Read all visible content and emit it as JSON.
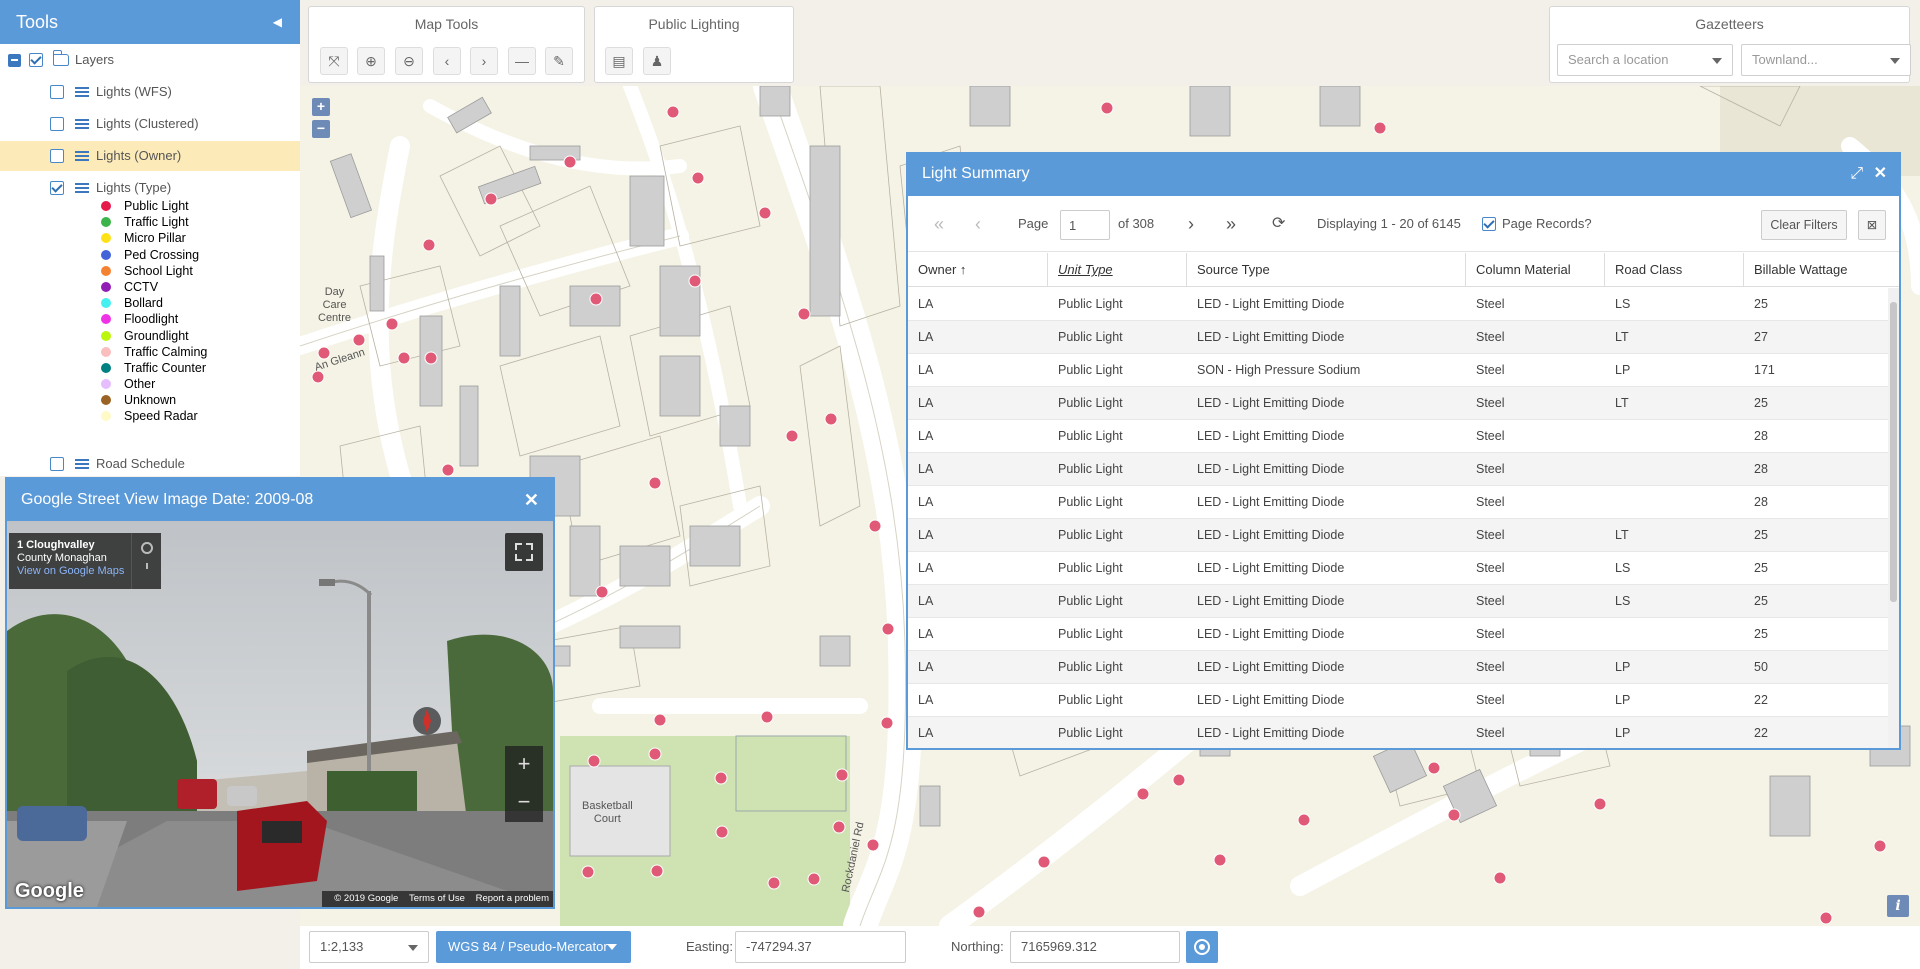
{
  "tools": {
    "title": "Tools",
    "layers_label": "Layers",
    "items": [
      {
        "label": "Lights (WFS)",
        "checked": false
      },
      {
        "label": "Lights (Clustered)",
        "checked": false
      },
      {
        "label": "Lights (Owner)",
        "checked": false
      },
      {
        "label": "Lights (Type)",
        "checked": true
      },
      {
        "label": "Road Schedule",
        "checked": false
      }
    ],
    "legend": [
      {
        "label": "Public Light",
        "color": "#e6194b"
      },
      {
        "label": "Traffic Light",
        "color": "#3cb44b"
      },
      {
        "label": "Micro Pillar",
        "color": "#ffe119"
      },
      {
        "label": "Ped Crossing",
        "color": "#4363d8"
      },
      {
        "label": "School Light",
        "color": "#f58231"
      },
      {
        "label": "CCTV",
        "color": "#911eb4"
      },
      {
        "label": "Bollard",
        "color": "#46f0f0"
      },
      {
        "label": "Floodlight",
        "color": "#f032e6"
      },
      {
        "label": "Groundlight",
        "color": "#bcf60c"
      },
      {
        "label": "Traffic Calming",
        "color": "#fabebe"
      },
      {
        "label": "Traffic Counter",
        "color": "#008080"
      },
      {
        "label": "Other",
        "color": "#e6beff"
      },
      {
        "label": "Unknown",
        "color": "#9a6324"
      },
      {
        "label": "Speed Radar",
        "color": "#fffac8"
      }
    ]
  },
  "map_tools": {
    "title": "Map Tools"
  },
  "public_lighting": {
    "title": "Public Lighting"
  },
  "gazetteers": {
    "title": "Gazetteers",
    "location_placeholder": "Search a location",
    "townland_placeholder": "Townland..."
  },
  "map": {
    "labels": {
      "day_care": "Day\nCare\nCentre",
      "an_gleann": "An Gleann",
      "basketball": "Basketball\nCourt",
      "rockdaniel": "Rockdaniel Rd"
    },
    "zoom_in": "+",
    "zoom_out": "−",
    "info": "i"
  },
  "summary": {
    "title": "Light Summary",
    "page_label": "Page",
    "page_value": "1",
    "of_pages": "of 308",
    "displaying": "Displaying 1 - 20 of 6145",
    "page_records": "Page Records?",
    "clear_filters": "Clear Filters",
    "columns": [
      "Owner",
      "Unit Type",
      "Source Type",
      "Column Material",
      "Road Class",
      "Billable Wattage"
    ],
    "rows": [
      [
        "LA",
        "Public Light",
        "LED - Light Emitting Diode",
        "Steel",
        "LS",
        "25"
      ],
      [
        "LA",
        "Public Light",
        "LED - Light Emitting Diode",
        "Steel",
        "LT",
        "27"
      ],
      [
        "LA",
        "Public Light",
        "SON - High Pressure Sodium",
        "Steel",
        "LP",
        "171"
      ],
      [
        "LA",
        "Public Light",
        "LED - Light Emitting Diode",
        "Steel",
        "LT",
        "25"
      ],
      [
        "LA",
        "Public Light",
        "LED - Light Emitting Diode",
        "Steel",
        "",
        "28"
      ],
      [
        "LA",
        "Public Light",
        "LED - Light Emitting Diode",
        "Steel",
        "",
        "28"
      ],
      [
        "LA",
        "Public Light",
        "LED - Light Emitting Diode",
        "Steel",
        "",
        "28"
      ],
      [
        "LA",
        "Public Light",
        "LED - Light Emitting Diode",
        "Steel",
        "LT",
        "25"
      ],
      [
        "LA",
        "Public Light",
        "LED - Light Emitting Diode",
        "Steel",
        "LS",
        "25"
      ],
      [
        "LA",
        "Public Light",
        "LED - Light Emitting Diode",
        "Steel",
        "LS",
        "25"
      ],
      [
        "LA",
        "Public Light",
        "LED - Light Emitting Diode",
        "Steel",
        "",
        "25"
      ],
      [
        "LA",
        "Public Light",
        "LED - Light Emitting Diode",
        "Steel",
        "LP",
        "50"
      ],
      [
        "LA",
        "Public Light",
        "LED - Light Emitting Diode",
        "Steel",
        "LP",
        "22"
      ],
      [
        "LA",
        "Public Light",
        "LED - Light Emitting Diode",
        "Steel",
        "LP",
        "22"
      ]
    ]
  },
  "streetview": {
    "title": "Google Street View Image Date: 2009-08",
    "address_line1": "1 Cloughvalley",
    "address_line2": "County Monaghan",
    "maps_link": "View on Google Maps",
    "copyright": "© 2019 Google",
    "terms": "Terms of Use",
    "report": "Report a problem",
    "google": "Google"
  },
  "bottom": {
    "scale": "1:2,133",
    "projection": "WGS 84 / Pseudo-Mercator",
    "easting_label": "Easting:",
    "easting_value": "-747294.37",
    "northing_label": "Northing:",
    "northing_value": "7165969.312"
  },
  "colors": {
    "accent": "#5b9ad8",
    "light_dot": "#e05a78",
    "highlight": "#fcebb8"
  }
}
